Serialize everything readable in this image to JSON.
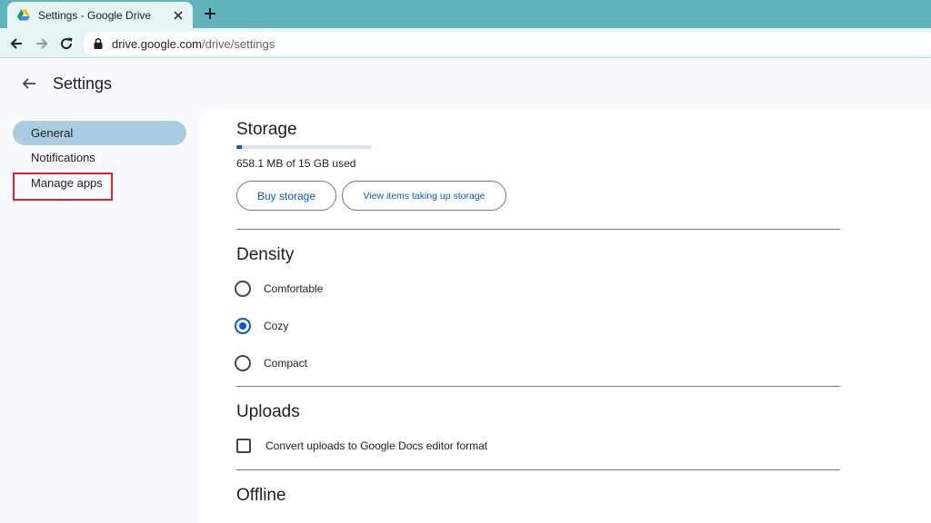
{
  "browser": {
    "tab_title": "Settings - Google Drive",
    "url_host": "drive.google.com",
    "url_path": "/drive/settings",
    "favicon": "google-drive-icon",
    "accent_color": "#5fb3bd"
  },
  "header": {
    "title": "Settings"
  },
  "sidebar": {
    "items": [
      {
        "label": "General",
        "active": true
      },
      {
        "label": "Notifications",
        "active": false
      },
      {
        "label": "Manage apps",
        "active": false,
        "highlighted": true
      }
    ]
  },
  "storage": {
    "title": "Storage",
    "used_fraction": 0.043,
    "usage_text": "658.1 MB of 15 GB used",
    "buy_label": "Buy storage",
    "view_label": "View items taking up storage"
  },
  "density": {
    "title": "Density",
    "options": [
      {
        "label": "Comfortable",
        "checked": false
      },
      {
        "label": "Cozy",
        "checked": true
      },
      {
        "label": "Compact",
        "checked": false
      }
    ]
  },
  "uploads": {
    "title": "Uploads",
    "convert_label": "Convert uploads to Google Docs editor format",
    "convert_checked": false
  },
  "offline": {
    "title": "Offline"
  }
}
